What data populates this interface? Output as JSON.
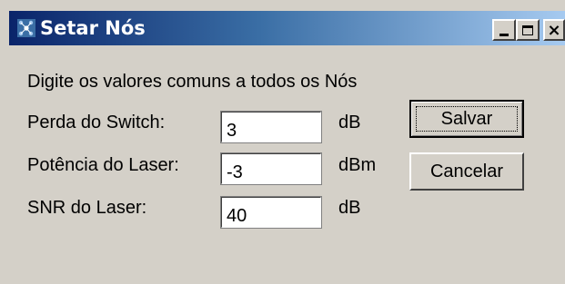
{
  "window": {
    "title": "Setar Nós",
    "icon": "network-nodes-icon",
    "controls": {
      "minimize": "minimize-icon",
      "maximize": "maximize-icon",
      "close": "×"
    },
    "title_gradient": [
      "#0a246a",
      "#a6caf0"
    ]
  },
  "instructions": "Digite os valores comuns a todos os Nós",
  "fields": [
    {
      "label": "Perda do Switch:",
      "value": "3",
      "unit": "dB"
    },
    {
      "label": "Potência do Laser:",
      "value": "-3",
      "unit": "dBm"
    },
    {
      "label": "SNR do Laser:",
      "value": "40",
      "unit": "dB"
    }
  ],
  "buttons": {
    "save": "Salvar",
    "cancel": "Cancelar"
  },
  "colors": {
    "face": "#d4d0c8",
    "field_bg": "#ffffff"
  }
}
